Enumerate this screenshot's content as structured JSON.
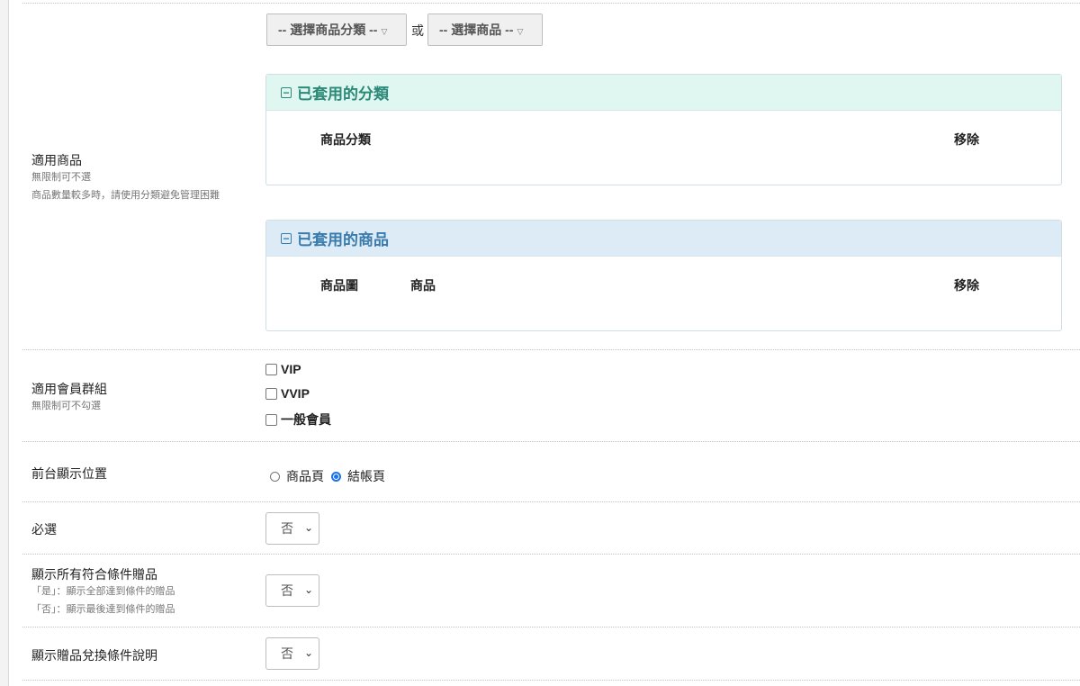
{
  "applicable_products": {
    "label": "適用商品",
    "hints": [
      "無限制可不選",
      "商品數量較多時，請使用分類避免管理困難"
    ],
    "category_select_label": "-- 選擇商品分類 --",
    "or_text": "或",
    "product_select_label": "-- 選擇商品 --",
    "category_panel": {
      "title": "已套用的分類",
      "columns": [
        "商品分類",
        "移除"
      ]
    },
    "product_panel": {
      "title": "已套用的商品",
      "columns": [
        "商品圖",
        "商品",
        "移除"
      ]
    }
  },
  "member_groups": {
    "label": "適用會員群組",
    "hint": "無限制可不勾選",
    "options": [
      {
        "label": "VIP",
        "checked": false
      },
      {
        "label": "VVIP",
        "checked": false
      },
      {
        "label": "一般會員",
        "checked": false
      }
    ]
  },
  "display_position": {
    "label": "前台顯示位置",
    "options": [
      {
        "label": "商品頁",
        "selected": false
      },
      {
        "label": "結帳頁",
        "selected": true
      }
    ]
  },
  "required": {
    "label": "必選",
    "value": "否"
  },
  "show_all_gifts": {
    "label": "顯示所有符合條件贈品",
    "hints": [
      "「是」：顯示全部達到條件的贈品",
      "「否」：顯示最後達到條件的贈品"
    ],
    "value": "否"
  },
  "show_redeem_desc": {
    "label": "顯示贈品兌換條件說明",
    "value": "否"
  },
  "icons": {
    "collapse": "minus-square-icon",
    "caret": "caret-down-icon",
    "select_chevron": "chevron-down-icon"
  },
  "colors": {
    "category_header_bg": "#dff6f1",
    "category_header_text": "#2b8a78",
    "product_header_bg": "#dcebf5",
    "product_header_text": "#3a7bad",
    "radio_accent": "#1a73e8"
  }
}
